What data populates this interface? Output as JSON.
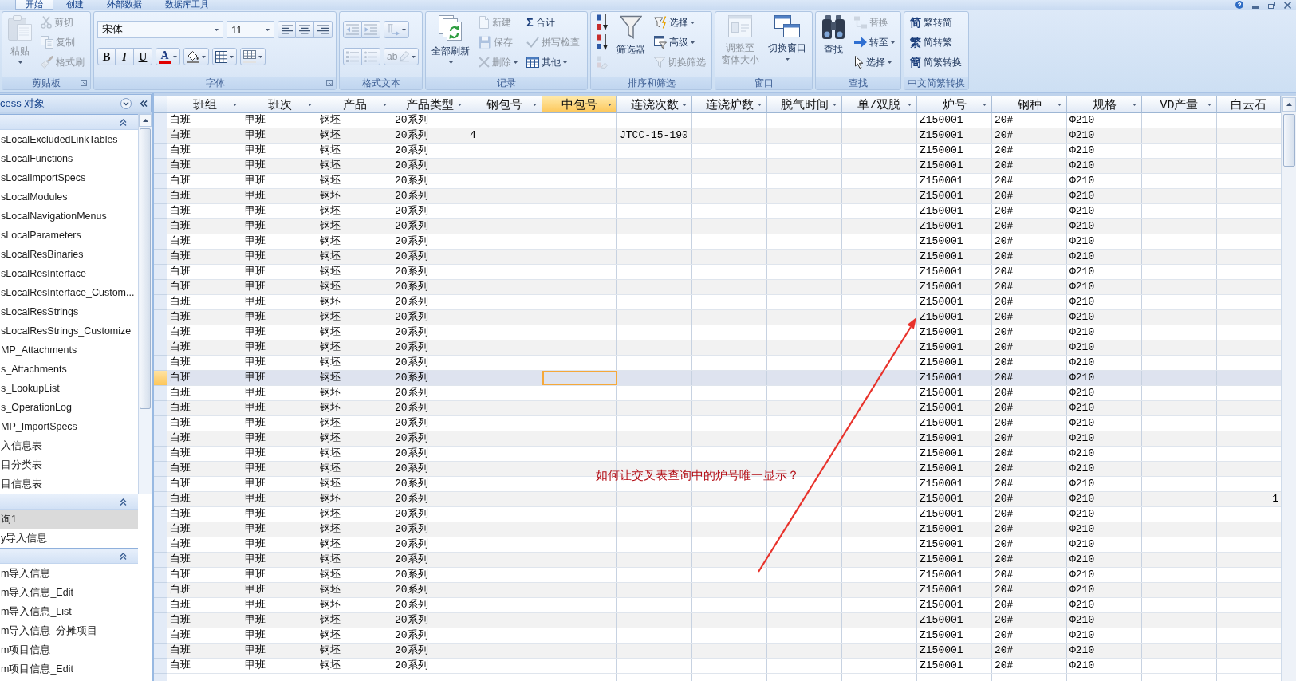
{
  "ribbon_tabs": [
    {
      "label": "开始",
      "selected": true
    },
    {
      "label": "创建",
      "selected": false
    },
    {
      "label": "外部数据",
      "selected": false
    },
    {
      "label": "数据库工具",
      "selected": false
    }
  ],
  "ribbon": [
    {
      "kind": "buttons",
      "label": "剪贴板",
      "launcher": true,
      "items": [
        {
          "kind": "paste",
          "label": "粘贴",
          "large": true,
          "menu": true,
          "disabled": true
        },
        {
          "kind": "cut",
          "label": "剪切",
          "large": false,
          "menu": false,
          "disabled": true
        },
        {
          "kind": "copy",
          "label": "复制",
          "large": false,
          "menu": false,
          "disabled": true
        },
        {
          "kind": "format-painter",
          "label": "格式刷",
          "large": false,
          "menu": false,
          "disabled": true
        }
      ]
    },
    {
      "kind": "font",
      "label": "字体",
      "launcher": true,
      "font_name": "宋体",
      "font_size": "11",
      "align": [
        {
          "kind": "align-left"
        },
        {
          "kind": "align-center"
        },
        {
          "kind": "align-right"
        }
      ],
      "styles": [
        {
          "kind": "bold",
          "label": "B"
        },
        {
          "kind": "italic",
          "label": "I"
        },
        {
          "kind": "underline",
          "label": "U"
        }
      ],
      "colors": [
        {
          "kind": "font-color",
          "label": "A",
          "menu": true
        },
        {
          "kind": "fill-color",
          "menu": true
        },
        {
          "kind": "gridlines",
          "menu": true
        },
        {
          "kind": "alternate-fill",
          "menu": true
        }
      ]
    },
    {
      "kind": "richtext",
      "label": "格式文本",
      "launcher": false,
      "rows": [
        [
          {
            "kind": "outdent",
            "menu": false,
            "disabled": true
          },
          {
            "kind": "indent",
            "menu": false,
            "disabled": true
          },
          {
            "kind": "ltr",
            "menu": true,
            "disabled": true
          }
        ],
        [
          {
            "kind": "numbered",
            "menu": false,
            "disabled": true
          },
          {
            "kind": "bullets",
            "menu": false,
            "disabled": true
          },
          {
            "kind": "highlight",
            "label": "ab",
            "menu": true,
            "disabled": true
          }
        ]
      ]
    },
    {
      "kind": "buttons",
      "label": "记录",
      "launcher": false,
      "items": [
        {
          "kind": "refresh",
          "label": "全部刷新",
          "large": true,
          "menu": true,
          "disabled": false
        },
        {
          "kind": "new",
          "label": "新建",
          "large": false,
          "menu": false,
          "disabled": true
        },
        {
          "kind": "save",
          "label": "保存",
          "large": false,
          "menu": false,
          "disabled": true
        },
        {
          "kind": "delete",
          "label": "删除",
          "large": false,
          "menu": true,
          "disabled": true
        },
        {
          "kind": "totals",
          "glyph": "Σ",
          "label": "合计",
          "large": false,
          "menu": false,
          "disabled": false
        },
        {
          "kind": "spelling",
          "label": "拼写检查",
          "large": false,
          "menu": false,
          "disabled": true
        },
        {
          "kind": "more",
          "label": "其他",
          "large": false,
          "menu": true,
          "disabled": false
        }
      ]
    },
    {
      "kind": "buttons",
      "label": "排序和筛选",
      "launcher": false,
      "items": [
        {
          "kind": "sort-ascending",
          "large": false,
          "menu": false,
          "disabled": false
        },
        {
          "kind": "sort-descending",
          "large": false,
          "menu": false,
          "disabled": false
        },
        {
          "kind": "clear-sort",
          "large": false,
          "menu": false,
          "disabled": true
        },
        {
          "kind": "filter",
          "label": "筛选器",
          "large": true,
          "menu": false,
          "disabled": false
        },
        {
          "kind": "selection",
          "label": "选择",
          "large": false,
          "menu": true,
          "disabled": false
        },
        {
          "kind": "advanced",
          "label": "高级",
          "large": false,
          "menu": true,
          "disabled": false
        },
        {
          "kind": "toggle-filter",
          "label": "切换筛选",
          "large": false,
          "menu": false,
          "disabled": true
        }
      ]
    },
    {
      "kind": "buttons",
      "label": "窗口",
      "launcher": false,
      "items": [
        {
          "kind": "size-to-fit",
          "lines": [
            "调整至",
            "窗体大小"
          ],
          "large": true,
          "menu": false,
          "disabled": true
        },
        {
          "kind": "switch-windows",
          "label": "切换窗口",
          "large": true,
          "menu": true,
          "disabled": false
        }
      ]
    },
    {
      "kind": "buttons",
      "label": "查找",
      "launcher": false,
      "items": [
        {
          "kind": "find",
          "label": "查找",
          "large": true,
          "menu": false,
          "disabled": false
        },
        {
          "kind": "replace",
          "label": "替换",
          "large": false,
          "menu": false,
          "disabled": true
        },
        {
          "kind": "goto",
          "label": "转至",
          "large": false,
          "menu": true,
          "disabled": false
        },
        {
          "kind": "select",
          "label": "选择",
          "large": false,
          "menu": true,
          "disabled": false
        }
      ]
    },
    {
      "kind": "buttons",
      "label": "中文简繁转换",
      "launcher": false,
      "items": [
        {
          "kind": "to-simplified",
          "glyph": "简",
          "label": "繁转简",
          "large": false,
          "menu": false,
          "disabled": false
        },
        {
          "kind": "to-traditional",
          "glyph": "繁",
          "label": "简转繁",
          "large": false,
          "menu": false,
          "disabled": false
        },
        {
          "kind": "convert",
          "glyph": "簡",
          "label": "简繁转换",
          "large": false,
          "menu": false,
          "disabled": false
        }
      ]
    }
  ],
  "nav": {
    "title": "cess 对象",
    "groups": [
      {
        "expanded": true,
        "items": [
          {
            "label": "sLocalExcludedLinkTables",
            "selected": false
          },
          {
            "label": "sLocalFunctions",
            "selected": false
          },
          {
            "label": "sLocalImportSpecs",
            "selected": false
          },
          {
            "label": "sLocalModules",
            "selected": false
          },
          {
            "label": "sLocalNavigationMenus",
            "selected": false
          },
          {
            "label": "sLocalParameters",
            "selected": false
          },
          {
            "label": "sLocalResBinaries",
            "selected": false
          },
          {
            "label": "sLocalResInterface",
            "selected": false
          },
          {
            "label": "sLocalResInterface_Custom...",
            "selected": false
          },
          {
            "label": "sLocalResStrings",
            "selected": false
          },
          {
            "label": "sLocalResStrings_Customize",
            "selected": false
          },
          {
            "label": "MP_Attachments",
            "selected": false
          },
          {
            "label": "s_Attachments",
            "selected": false
          },
          {
            "label": "s_LookupList",
            "selected": false
          },
          {
            "label": "s_OperationLog",
            "selected": false
          },
          {
            "label": "MP_ImportSpecs",
            "selected": false
          },
          {
            "label": "入信息表",
            "selected": false
          },
          {
            "label": "目分类表",
            "selected": false
          },
          {
            "label": "目信息表",
            "selected": false
          }
        ]
      },
      {
        "expanded": true,
        "items": [
          {
            "label": "询1",
            "selected": true
          },
          {
            "label": "y导入信息",
            "selected": false
          }
        ]
      },
      {
        "expanded": true,
        "items": [
          {
            "label": "m导入信息",
            "selected": false
          },
          {
            "label": "m导入信息_Edit",
            "selected": false
          },
          {
            "label": "m导入信息_List",
            "selected": false
          },
          {
            "label": "m导入信息_分摊项目",
            "selected": false
          },
          {
            "label": "m项目信息",
            "selected": false
          },
          {
            "label": "m项目信息_Edit",
            "selected": false
          }
        ]
      }
    ]
  },
  "datasheet": {
    "columns": [
      {
        "label": "班组",
        "selected": false
      },
      {
        "label": "班次",
        "selected": false
      },
      {
        "label": "产品",
        "selected": false
      },
      {
        "label": "产品类型",
        "selected": false
      },
      {
        "label": "钢包号",
        "selected": false
      },
      {
        "label": "中包号",
        "selected": true
      },
      {
        "label": "连浇次数",
        "selected": false
      },
      {
        "label": "连浇炉数",
        "selected": false
      },
      {
        "label": "脱气时间",
        "selected": false
      },
      {
        "label": "单/双脱",
        "selected": false
      },
      {
        "label": "炉号",
        "selected": false
      },
      {
        "label": "钢种",
        "selected": false
      },
      {
        "label": "规格",
        "selected": false
      },
      {
        "label": "VD产量",
        "selected": false
      },
      {
        "label": "白云石",
        "selected": false
      }
    ],
    "rows": [
      {
        "selected": false,
        "cells": [
          "白班",
          "甲班",
          "钢坯",
          "20系列",
          null,
          null,
          null,
          null,
          null,
          null,
          "Z150001",
          "20#",
          "Φ210",
          null,
          null
        ]
      },
      {
        "selected": false,
        "cells": [
          "白班",
          "甲班",
          "钢坯",
          "20系列",
          "4",
          null,
          "JTCC-15-190",
          null,
          null,
          null,
          "Z150001",
          "20#",
          "Φ210",
          null,
          null
        ]
      },
      {
        "selected": false,
        "cells": [
          "白班",
          "甲班",
          "钢坯",
          "20系列",
          null,
          null,
          null,
          null,
          null,
          null,
          "Z150001",
          "20#",
          "Φ210",
          null,
          null
        ]
      },
      {
        "selected": false,
        "cells": [
          "白班",
          "甲班",
          "钢坯",
          "20系列",
          null,
          null,
          null,
          null,
          null,
          null,
          "Z150001",
          "20#",
          "Φ210",
          null,
          null
        ]
      },
      {
        "selected": false,
        "cells": [
          "白班",
          "甲班",
          "钢坯",
          "20系列",
          null,
          null,
          null,
          null,
          null,
          null,
          "Z150001",
          "20#",
          "Φ210",
          null,
          null
        ]
      },
      {
        "selected": false,
        "cells": [
          "白班",
          "甲班",
          "钢坯",
          "20系列",
          null,
          null,
          null,
          null,
          null,
          null,
          "Z150001",
          "20#",
          "Φ210",
          null,
          null
        ]
      },
      {
        "selected": false,
        "cells": [
          "白班",
          "甲班",
          "钢坯",
          "20系列",
          null,
          null,
          null,
          null,
          null,
          null,
          "Z150001",
          "20#",
          "Φ210",
          null,
          null
        ]
      },
      {
        "selected": false,
        "cells": [
          "白班",
          "甲班",
          "钢坯",
          "20系列",
          null,
          null,
          null,
          null,
          null,
          null,
          "Z150001",
          "20#",
          "Φ210",
          null,
          null
        ]
      },
      {
        "selected": false,
        "cells": [
          "白班",
          "甲班",
          "钢坯",
          "20系列",
          null,
          null,
          null,
          null,
          null,
          null,
          "Z150001",
          "20#",
          "Φ210",
          null,
          null
        ]
      },
      {
        "selected": false,
        "cells": [
          "白班",
          "甲班",
          "钢坯",
          "20系列",
          null,
          null,
          null,
          null,
          null,
          null,
          "Z150001",
          "20#",
          "Φ210",
          null,
          null
        ]
      },
      {
        "selected": false,
        "cells": [
          "白班",
          "甲班",
          "钢坯",
          "20系列",
          null,
          null,
          null,
          null,
          null,
          null,
          "Z150001",
          "20#",
          "Φ210",
          null,
          null
        ]
      },
      {
        "selected": false,
        "cells": [
          "白班",
          "甲班",
          "钢坯",
          "20系列",
          null,
          null,
          null,
          null,
          null,
          null,
          "Z150001",
          "20#",
          "Φ210",
          null,
          null
        ]
      },
      {
        "selected": false,
        "cells": [
          "白班",
          "甲班",
          "钢坯",
          "20系列",
          null,
          null,
          null,
          null,
          null,
          null,
          "Z150001",
          "20#",
          "Φ210",
          null,
          null
        ]
      },
      {
        "selected": false,
        "cells": [
          "白班",
          "甲班",
          "钢坯",
          "20系列",
          null,
          null,
          null,
          null,
          null,
          null,
          "Z150001",
          "20#",
          "Φ210",
          null,
          null
        ]
      },
      {
        "selected": false,
        "cells": [
          "白班",
          "甲班",
          "钢坯",
          "20系列",
          null,
          null,
          null,
          null,
          null,
          null,
          "Z150001",
          "20#",
          "Φ210",
          null,
          null
        ]
      },
      {
        "selected": false,
        "cells": [
          "白班",
          "甲班",
          "钢坯",
          "20系列",
          null,
          null,
          null,
          null,
          null,
          null,
          "Z150001",
          "20#",
          "Φ210",
          null,
          null
        ]
      },
      {
        "selected": false,
        "cells": [
          "白班",
          "甲班",
          "钢坯",
          "20系列",
          null,
          null,
          null,
          null,
          null,
          null,
          "Z150001",
          "20#",
          "Φ210",
          null,
          null
        ]
      },
      {
        "selected": true,
        "cells": [
          "白班",
          "甲班",
          "钢坯",
          "20系列",
          null,
          null,
          null,
          null,
          null,
          null,
          "Z150001",
          "20#",
          "Φ210",
          null,
          null
        ]
      },
      {
        "selected": false,
        "cells": [
          "白班",
          "甲班",
          "钢坯",
          "20系列",
          null,
          null,
          null,
          null,
          null,
          null,
          "Z150001",
          "20#",
          "Φ210",
          null,
          null
        ]
      },
      {
        "selected": false,
        "cells": [
          "白班",
          "甲班",
          "钢坯",
          "20系列",
          null,
          null,
          null,
          null,
          null,
          null,
          "Z150001",
          "20#",
          "Φ210",
          null,
          null
        ]
      },
      {
        "selected": false,
        "cells": [
          "白班",
          "甲班",
          "钢坯",
          "20系列",
          null,
          null,
          null,
          null,
          null,
          null,
          "Z150001",
          "20#",
          "Φ210",
          null,
          null
        ]
      },
      {
        "selected": false,
        "cells": [
          "白班",
          "甲班",
          "钢坯",
          "20系列",
          null,
          null,
          null,
          null,
          null,
          null,
          "Z150001",
          "20#",
          "Φ210",
          null,
          null
        ]
      },
      {
        "selected": false,
        "cells": [
          "白班",
          "甲班",
          "钢坯",
          "20系列",
          null,
          null,
          null,
          null,
          null,
          null,
          "Z150001",
          "20#",
          "Φ210",
          null,
          null
        ]
      },
      {
        "selected": false,
        "cells": [
          "白班",
          "甲班",
          "钢坯",
          "20系列",
          null,
          null,
          null,
          null,
          null,
          null,
          "Z150001",
          "20#",
          "Φ210",
          null,
          null
        ]
      },
      {
        "selected": false,
        "cells": [
          "白班",
          "甲班",
          "钢坯",
          "20系列",
          null,
          null,
          null,
          null,
          null,
          null,
          "Z150001",
          "20#",
          "Φ210",
          null,
          null
        ]
      },
      {
        "selected": false,
        "cells": [
          "白班",
          "甲班",
          "钢坯",
          "20系列",
          null,
          null,
          null,
          null,
          null,
          null,
          "Z150001",
          "20#",
          "Φ210",
          null,
          "1"
        ]
      },
      {
        "selected": false,
        "cells": [
          "白班",
          "甲班",
          "钢坯",
          "20系列",
          null,
          null,
          null,
          null,
          null,
          null,
          "Z150001",
          "20#",
          "Φ210",
          null,
          null
        ]
      },
      {
        "selected": false,
        "cells": [
          "白班",
          "甲班",
          "钢坯",
          "20系列",
          null,
          null,
          null,
          null,
          null,
          null,
          "Z150001",
          "20#",
          "Φ210",
          null,
          null
        ]
      },
      {
        "selected": false,
        "cells": [
          "白班",
          "甲班",
          "钢坯",
          "20系列",
          null,
          null,
          null,
          null,
          null,
          null,
          "Z150001",
          "20#",
          "Φ210",
          null,
          null
        ]
      },
      {
        "selected": false,
        "cells": [
          "白班",
          "甲班",
          "钢坯",
          "20系列",
          null,
          null,
          null,
          null,
          null,
          null,
          "Z150001",
          "20#",
          "Φ210",
          null,
          null
        ]
      },
      {
        "selected": false,
        "cells": [
          "白班",
          "甲班",
          "钢坯",
          "20系列",
          null,
          null,
          null,
          null,
          null,
          null,
          "Z150001",
          "20#",
          "Φ210",
          null,
          null
        ]
      },
      {
        "selected": false,
        "cells": [
          "白班",
          "甲班",
          "钢坯",
          "20系列",
          null,
          null,
          null,
          null,
          null,
          null,
          "Z150001",
          "20#",
          "Φ210",
          null,
          null
        ]
      },
      {
        "selected": false,
        "cells": [
          "白班",
          "甲班",
          "钢坯",
          "20系列",
          null,
          null,
          null,
          null,
          null,
          null,
          "Z150001",
          "20#",
          "Φ210",
          null,
          null
        ]
      },
      {
        "selected": false,
        "cells": [
          "白班",
          "甲班",
          "钢坯",
          "20系列",
          null,
          null,
          null,
          null,
          null,
          null,
          "Z150001",
          "20#",
          "Φ210",
          null,
          null
        ]
      },
      {
        "selected": false,
        "cells": [
          "白班",
          "甲班",
          "钢坯",
          "20系列",
          null,
          null,
          null,
          null,
          null,
          null,
          "Z150001",
          "20#",
          "Φ210",
          null,
          null
        ]
      },
      {
        "selected": false,
        "cells": [
          "白班",
          "甲班",
          "钢坯",
          "20系列",
          null,
          null,
          null,
          null,
          null,
          null,
          "Z150001",
          "20#",
          "Φ210",
          null,
          null
        ]
      },
      {
        "selected": false,
        "cells": [
          "白班",
          "甲班",
          "钢坯",
          "20系列",
          null,
          null,
          null,
          null,
          null,
          null,
          "Z150001",
          "20#",
          "Φ210",
          null,
          null
        ]
      }
    ]
  },
  "annotation": {
    "text": "如何让交叉表查询中的炉号唯一显示？"
  }
}
